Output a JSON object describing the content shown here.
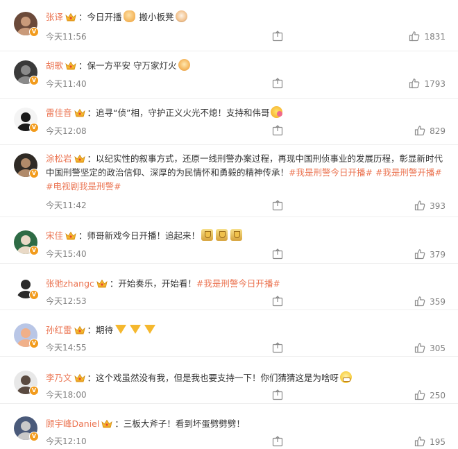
{
  "comments": [
    {
      "name": "张译",
      "verified": true,
      "crown": true,
      "parts": [
        {
          "t": "今日开播"
        },
        {
          "emoji": "thumbs-up-emoji"
        },
        {
          "t": " 搬小板凳"
        },
        {
          "emoji": "cat-emoji"
        }
      ],
      "time": "今天11:56",
      "likes": "1831",
      "avatar": {
        "bg": "#6b4a3a",
        "fg": "#c99a7a"
      }
    },
    {
      "name": "胡歌",
      "verified": true,
      "crown": true,
      "parts": [
        {
          "t": "保一方平安 守万家灯火"
        },
        {
          "emoji": "candle-emoji"
        }
      ],
      "time": "今天11:40",
      "likes": "1793",
      "avatar": {
        "bg": "#3a3a3a",
        "fg": "#8a8a8a"
      }
    },
    {
      "name": "雷佳音",
      "verified": true,
      "crown": true,
      "parts": [
        {
          "t": "追寻“侦”相，守护正义火光不熄！支持和伟哥"
        },
        {
          "emoji": "kiss-emoji"
        }
      ],
      "time": "今天12:08",
      "likes": "829",
      "avatar": {
        "bg": "#f4f4f4",
        "fg": "#1a1a1a"
      }
    },
    {
      "name": "涂松岩",
      "verified": true,
      "crown": true,
      "parts": [
        {
          "t": "以纪实性的叙事方式，还原一线刑警办案过程，再现中国刑侦事业的发展历程，彰显新时代中国刑警坚定的政治信仰、深厚的为民情怀和勇毅的精神传承！"
        },
        {
          "topic": "#我是刑警今日开播#"
        },
        {
          "t": " "
        },
        {
          "topic": "#我是刑警开播#"
        },
        {
          "t": " "
        },
        {
          "topic": "#电视剧我是刑警#"
        }
      ],
      "time": "今天11:42",
      "likes": "393",
      "avatar": {
        "bg": "#2f2a25",
        "fg": "#b08a6a"
      }
    },
    {
      "name": "宋佳",
      "verified": true,
      "crown": true,
      "parts": [
        {
          "t": "师哥新戏今日开播！追起来！"
        },
        {
          "emoji": "trophy-emoji"
        },
        {
          "emoji": "trophy-emoji"
        },
        {
          "emoji": "trophy-emoji"
        }
      ],
      "time": "今天15:40",
      "likes": "379",
      "avatar": {
        "bg": "#2e6b45",
        "fg": "#e9d9c6"
      }
    },
    {
      "name": "张弛zhangc",
      "verified": true,
      "crown": true,
      "parts": [
        {
          "t": "开始奏乐，开始看！"
        },
        {
          "topic": "#我是刑警今日开播#"
        }
      ],
      "time": "今天12:53",
      "likes": "359",
      "avatar": {
        "bg": "#ffffff",
        "fg": "#2a2a2a"
      }
    },
    {
      "name": "孙红雷",
      "verified": true,
      "crown": true,
      "parts": [
        {
          "t": "期待"
        },
        {
          "emoji": "pointing-down-emoji"
        },
        {
          "emoji": "pointing-down-emoji"
        },
        {
          "emoji": "pointing-down-emoji"
        }
      ],
      "time": "今天14:55",
      "likes": "305",
      "avatar": {
        "bg": "#b9c6e6",
        "fg": "#f0b08a"
      }
    },
    {
      "name": "李乃文",
      "verified": true,
      "crown": true,
      "parts": [
        {
          "t": "这个戏虽然没有我，但是我也要支持一下！你们猜猜这是为啥呀"
        },
        {
          "emoji": "grin-emoji"
        }
      ],
      "time": "今天18:00",
      "likes": "250",
      "avatar": {
        "bg": "#e8e8e8",
        "fg": "#5a4a40"
      }
    },
    {
      "name": "顾宇峰Daniel",
      "verified": true,
      "crown": true,
      "parts": [
        {
          "t": "三板大斧子！看到坏蛋劈劈劈！"
        }
      ],
      "time": "今天12:10",
      "likes": "195",
      "avatar": {
        "bg": "#4a5a7a",
        "fg": "#c9c9c9"
      }
    }
  ],
  "separator": "：",
  "verified_badge": "V",
  "colors": {
    "name": "#eb7350",
    "topic": "#eb7350",
    "meta": "#808080",
    "badge": "#f29b1c"
  },
  "icons": {
    "share": "share-icon",
    "like": "thumbs-up-icon",
    "crown": "crown-icon"
  }
}
